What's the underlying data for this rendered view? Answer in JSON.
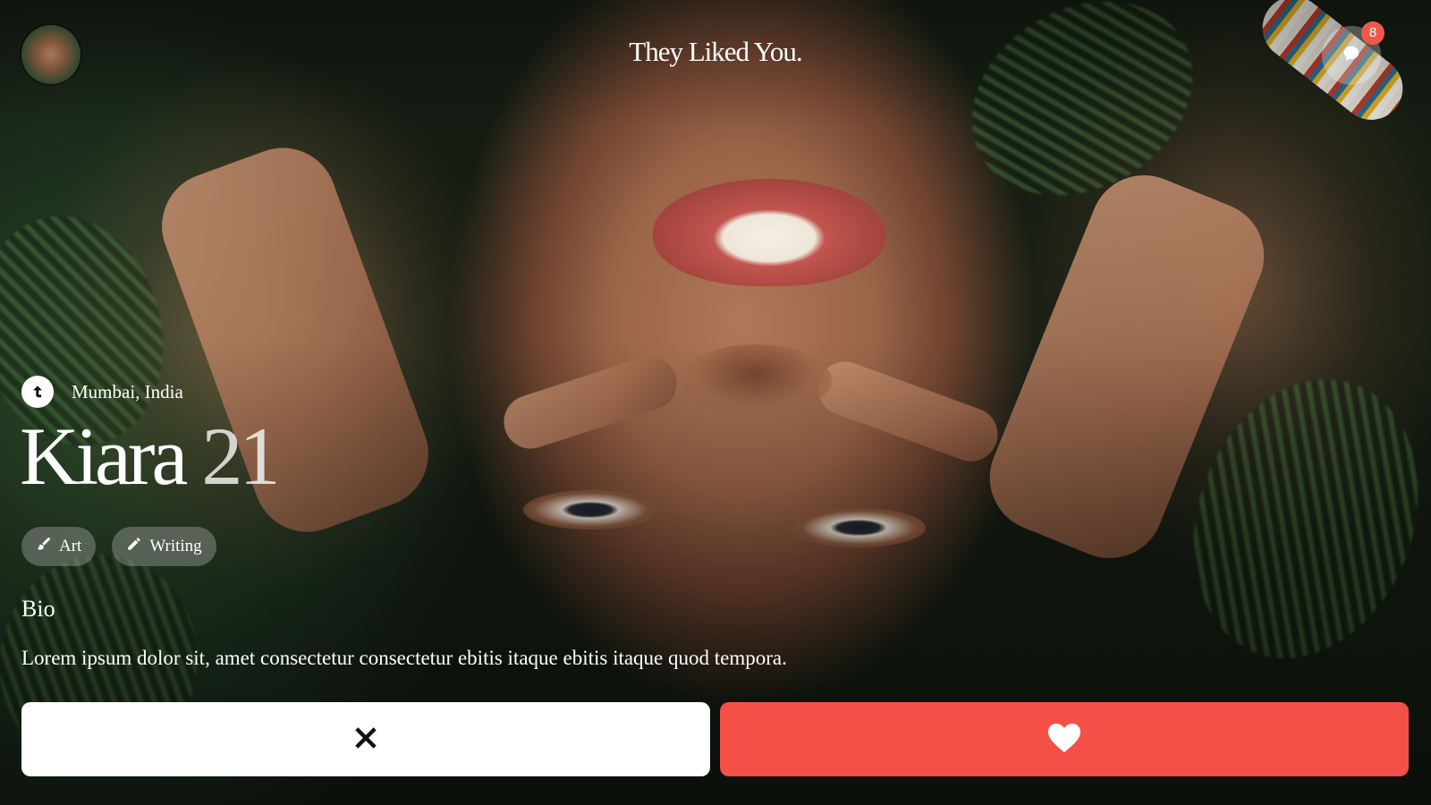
{
  "header": {
    "title": "They Liked You.",
    "messages_badge_count": "8",
    "avatar_icon": "user-avatar-photo",
    "messages_icon": "chat-bubble-icon"
  },
  "profile": {
    "location": "Mumbai, India",
    "location_icon": "arrow-up-circle-icon",
    "name": "Kiara",
    "age": "21",
    "interests": [
      {
        "label": "Art",
        "icon": "brush-icon"
      },
      {
        "label": "Writing",
        "icon": "pencil-icon"
      }
    ],
    "bio_heading": "Bio",
    "bio_text": "Lorem ipsum dolor sit, amet consectetur consectetur ebitis itaque ebitis itaque quod tempora."
  },
  "actions": {
    "pass_icon": "close-icon",
    "like_icon": "heart-icon"
  },
  "colors": {
    "like_button": "#f55048",
    "pass_button": "#ffffff",
    "badge": "#f2584a",
    "text": "#ffffff"
  }
}
